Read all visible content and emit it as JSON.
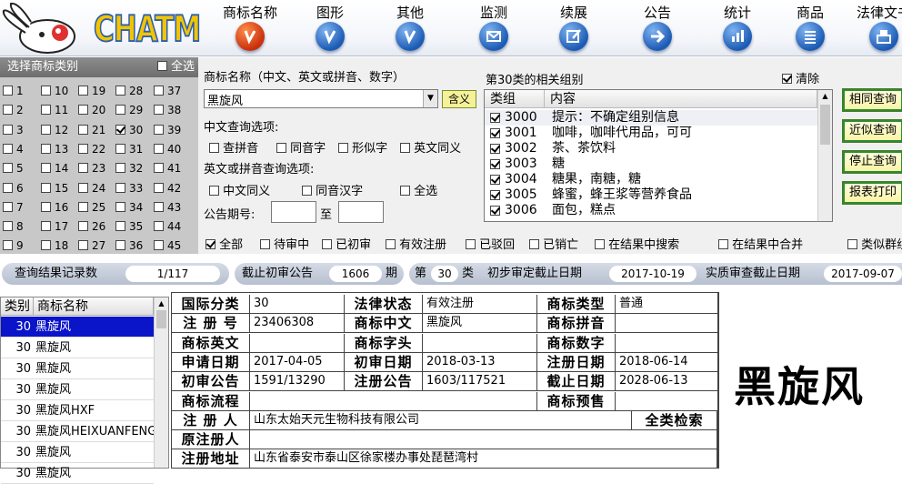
{
  "app": {
    "logo": "CHATM"
  },
  "nav": [
    {
      "label": "商标名称",
      "icon": "trademark-name-icon",
      "active": true
    },
    {
      "label": "图形",
      "icon": "graphic-icon"
    },
    {
      "label": "其他",
      "icon": "other-icon"
    },
    {
      "label": "监测",
      "icon": "monitor-mail-icon"
    },
    {
      "label": "续展",
      "icon": "renew-edit-icon"
    },
    {
      "label": "公告",
      "icon": "announce-arrow-icon"
    },
    {
      "label": "统计",
      "icon": "stats-chart-icon"
    },
    {
      "label": "商品",
      "icon": "goods-list-icon"
    },
    {
      "label": "法律文书",
      "icon": "legal-doc-icon"
    }
  ],
  "classes": {
    "title": "选择商标类别",
    "select_all": "全选",
    "checked": [
      "30"
    ],
    "columns": [
      [
        "1",
        "2",
        "3",
        "4",
        "5",
        "6",
        "7",
        "8",
        "9"
      ],
      [
        "10",
        "11",
        "12",
        "13",
        "14",
        "15",
        "16",
        "17",
        "18"
      ],
      [
        "19",
        "20",
        "21",
        "22",
        "23",
        "24",
        "25",
        "26",
        "27"
      ],
      [
        "28",
        "29",
        "30",
        "31",
        "32",
        "33",
        "34",
        "35",
        "36"
      ],
      [
        "37",
        "38",
        "39",
        "40",
        "41",
        "42",
        "43",
        "44",
        "45"
      ]
    ]
  },
  "query": {
    "name_label": "商标名称（中文、英文或拼音、数字）",
    "name_value": "黑旋风",
    "meaning_button": "含义",
    "cn_options_title": "中文查询选项:",
    "cn_options": [
      "查拼音",
      "同音字",
      "形似字",
      "英文同义"
    ],
    "en_options_title": "英文或拼音查询选项:",
    "en_options": [
      "中文同义",
      "同音汉字",
      "全选"
    ],
    "issue_label": "公告期号:",
    "issue_to": "至"
  },
  "groups": {
    "title": "第30类的相关组别",
    "clear_label": "清除",
    "clear_checked": true,
    "col_group": "类组",
    "col_content": "内容",
    "rows": [
      {
        "code": "3000",
        "content": "提示：不确定组别信息"
      },
      {
        "code": "3001",
        "content": "咖啡，咖啡代用品，可可"
      },
      {
        "code": "3002",
        "content": "茶、茶饮料"
      },
      {
        "code": "3003",
        "content": "糖"
      },
      {
        "code": "3004",
        "content": "糖果，南糖，糖"
      },
      {
        "code": "3005",
        "content": "蜂蜜，蜂王浆等营养食品"
      },
      {
        "code": "3006",
        "content": "面包，糕点"
      }
    ]
  },
  "actions": [
    "相同查询",
    "近似查询",
    "停止查询",
    "报表打印"
  ],
  "filters": [
    {
      "label": "全部",
      "checked": true
    },
    {
      "label": "待审中"
    },
    {
      "label": "已初审"
    },
    {
      "label": "有效注册"
    },
    {
      "label": "已驳回"
    },
    {
      "label": "已销亡"
    },
    {
      "label": "在结果中搜索"
    },
    {
      "label": "在结果中合并"
    },
    {
      "label": "类似群组"
    }
  ],
  "status": {
    "records_label": "查询结果记录数",
    "records_value": "1/117",
    "cutoff_label": "截止初审公告",
    "cutoff_value": "1606",
    "cutoff_unit": "期",
    "class_prefix": "第",
    "class_value": "30",
    "class_suffix": "类",
    "prelim_label": "初步审定截止日期",
    "prelim_value": "2017-10-19",
    "exam_label": "实质审查截止日期",
    "exam_value": "2017-09-07"
  },
  "results": {
    "col_class": "类别",
    "col_name": "商标名称",
    "rows": [
      {
        "cls": "30",
        "name": "黑旋风",
        "selected": true
      },
      {
        "cls": "30",
        "name": "黑旋风"
      },
      {
        "cls": "30",
        "name": "黑旋风"
      },
      {
        "cls": "30",
        "name": "黑旋风"
      },
      {
        "cls": "30",
        "name": "黑旋风HXF"
      },
      {
        "cls": "30",
        "name": "黑旋风HEIXUANFENG"
      },
      {
        "cls": "30",
        "name": "黑旋风"
      },
      {
        "cls": "30",
        "name": "黑旋风"
      }
    ]
  },
  "detail": {
    "intl_class_k": "国际分类",
    "intl_class_v": "30",
    "legal_status_k": "法律状态",
    "legal_status_v": "有效注册",
    "tm_type_k": "商标类型",
    "tm_type_v": "普通",
    "reg_no_k": "注 册 号",
    "reg_no_v": "23406308",
    "cn_name_k": "商标中文",
    "cn_name_v": "黑旋风",
    "pinyin_k": "商标拼音",
    "pinyin_v": "",
    "en_name_k": "商标英文",
    "en_name_v": "",
    "initial_k": "商标字头",
    "initial_v": "",
    "digits_k": "商标数字",
    "digits_v": "",
    "apply_date_k": "申请日期",
    "apply_date_v": "2017-04-05",
    "prelim_date_k": "初审日期",
    "prelim_date_v": "2018-03-13",
    "reg_date_k": "注册日期",
    "reg_date_v": "2018-06-14",
    "prelim_ann_k": "初审公告",
    "prelim_ann_v": "1591/13290",
    "reg_ann_k": "注册公告",
    "reg_ann_v": "1603/117521",
    "expire_k": "截止日期",
    "expire_v": "2028-06-13",
    "flow_k": "商标流程",
    "flow_v": "",
    "warn_k": "商标预售",
    "warn_v": "",
    "registrant_k": "注 册 人",
    "registrant_v": "山东太始天元生物科技有限公司",
    "all_class_link": "全类检索",
    "orig_k": "原注册人",
    "orig_v": "",
    "addr_k": "注册地址",
    "addr_v": "山东省泰安市泰山区徐家楼办事处琵琶湾村"
  },
  "preview": {
    "name": "黑旋风"
  }
}
